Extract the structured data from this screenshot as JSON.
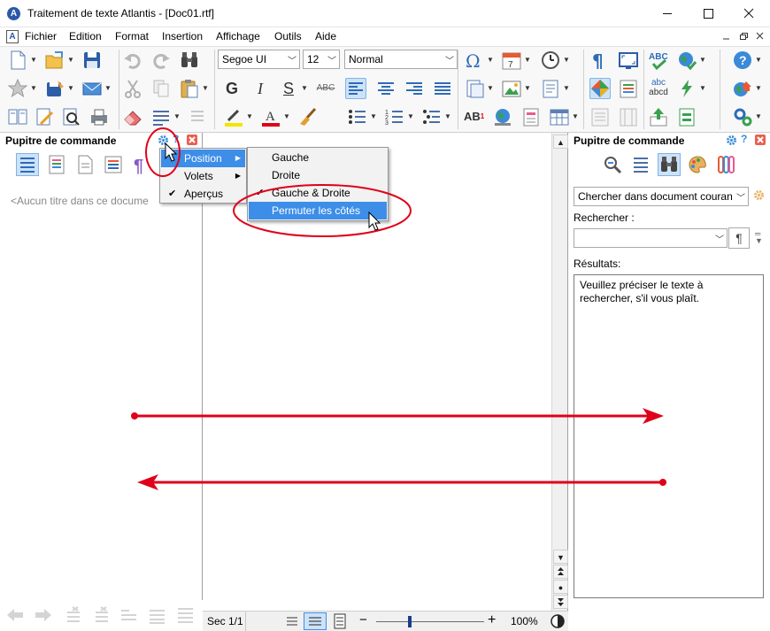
{
  "window": {
    "title": "Traitement de texte Atlantis - [Doc01.rtf]",
    "app_icon": "A",
    "controls": [
      "minimize-icon",
      "maximize-icon",
      "close-icon"
    ]
  },
  "menubar": {
    "doc_icon": "A",
    "items": [
      "Fichier",
      "Edition",
      "Format",
      "Insertion",
      "Affichage",
      "Outils",
      "Aide"
    ]
  },
  "toolbar": {
    "font_name": "Segoe UI",
    "font_size": "12",
    "style": "Normal",
    "bold_label": "G",
    "italic_label": "I",
    "underline_label": "S",
    "strike_label": "ABC",
    "superscript_label": "AB",
    "superscript_mark": "1",
    "abcd_top": "abc",
    "abcd_bottom": "abcd"
  },
  "left_panel": {
    "title": "Pupitre de commande",
    "placeholder": "<Aucun titre dans ce docume"
  },
  "context_menu": {
    "items": [
      {
        "label": "Position",
        "submenu": true,
        "highlighted": true
      },
      {
        "label": "Volets",
        "submenu": true,
        "highlighted": false
      },
      {
        "label": "Aperçus",
        "checked": true
      }
    ]
  },
  "position_submenu": {
    "items": [
      {
        "label": "Gauche",
        "checked": false,
        "highlighted": false
      },
      {
        "label": "Droite",
        "checked": false,
        "highlighted": false
      },
      {
        "label": "Gauche & Droite",
        "checked": true,
        "highlighted": false
      },
      {
        "label": "Permuter les côtés",
        "checked": false,
        "highlighted": true
      }
    ]
  },
  "right_panel": {
    "title": "Pupitre de commande",
    "scope_value": "Chercher dans document couran",
    "search_label": "Rechercher :",
    "search_value": "",
    "para_symbol": "¶",
    "results_label": "Résultats:",
    "results_text": "Veuillez préciser le texte à rechercher, s'il vous plaît."
  },
  "statusbar": {
    "section": "Sec 1/1",
    "zoom": "100%",
    "zoom_minus": "−",
    "zoom_plus": "+",
    "zoom_fraction": 0.31
  },
  "colors": {
    "accent": "#3d8ee8",
    "annotation_red": "#e0001a",
    "panel_border": "#a0a0a0"
  }
}
